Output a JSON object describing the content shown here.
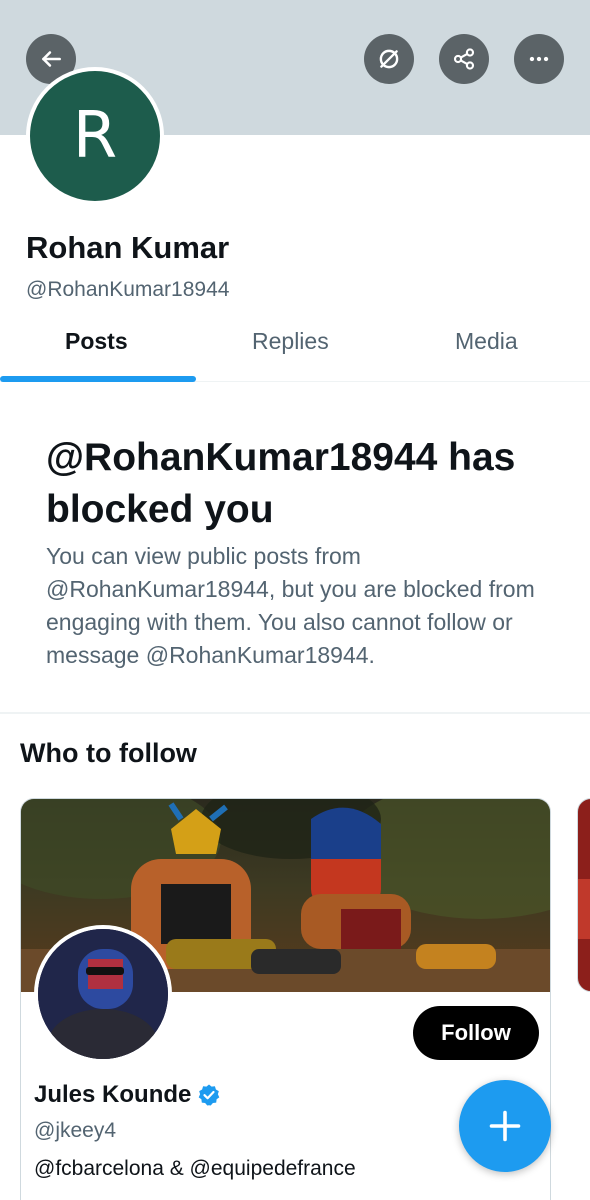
{
  "header": {
    "icons": [
      "back-arrow-icon",
      "notification-off-icon",
      "share-icon",
      "more-icon"
    ],
    "banner_color": "#cfd9de"
  },
  "profile": {
    "avatar_letter": "R",
    "avatar_color": "#1d5c4c",
    "display_name": "Rohan Kumar",
    "handle": "@RohanKumar18944"
  },
  "tabs": [
    {
      "label": "Posts",
      "active": true
    },
    {
      "label": "Replies",
      "active": false
    },
    {
      "label": "Media",
      "active": false
    }
  ],
  "blocked": {
    "title": "@RohanKumar18944 has blocked you",
    "description": "You can view public posts from @RohanKumar18944, but you are blocked from engaging with them. You also cannot follow or message @RohanKumar18944."
  },
  "who_to_follow": {
    "title": "Who to follow",
    "cards": [
      {
        "name": "Jules Kounde",
        "verified": true,
        "handle": "@jkeey4",
        "bio": "@fcbarcelona & @equipedefrance",
        "follow_label": "Follow"
      }
    ]
  },
  "fab": {
    "icon": "plus-icon"
  },
  "colors": {
    "accent": "#1d9bf0",
    "text": "#0f1419",
    "secondary_text": "#536471"
  }
}
